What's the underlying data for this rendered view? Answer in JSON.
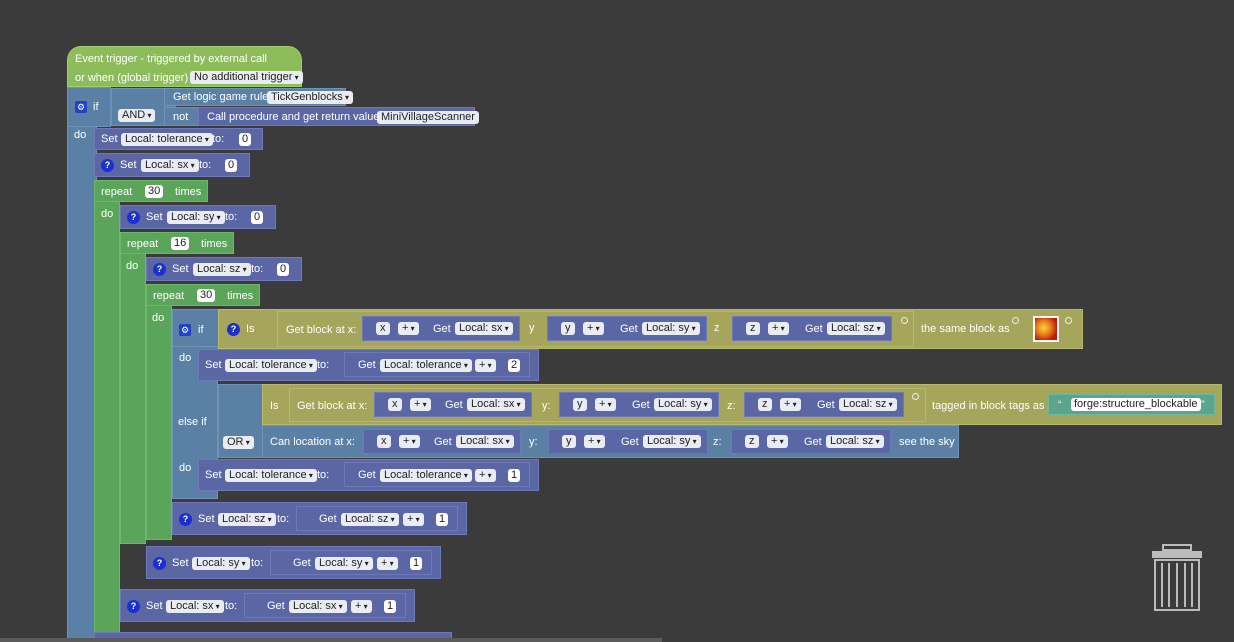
{
  "event": {
    "line1": "Event trigger - triggered by external call",
    "line2": "or when (global trigger)",
    "trigger_dropdown": "No additional trigger",
    "do": "do"
  },
  "if1": {
    "if": "if",
    "get_rule": "Get logic game rule",
    "rule_name": "TickGenblocks",
    "and": "AND",
    "not": "not",
    "call": "Call procedure and get return value",
    "proc_name": "MiniVillageScanner"
  },
  "set": "Set",
  "to": "to:",
  "get": "Get",
  "repeat": "repeat",
  "times": "times",
  "do": "do",
  "vars": {
    "tolerance": "Local: tolerance",
    "sx": "Local: sx",
    "sy": "Local: sy",
    "sz": "Local: sz"
  },
  "nums": {
    "zero": "0",
    "thirty": "30",
    "sixteen": "16",
    "one": "1",
    "two": "2"
  },
  "plus": "+",
  "coords": {
    "x": "x",
    "y": "y",
    "z": "z",
    "yc": "y:",
    "zc": "z:"
  },
  "if2": {
    "if": "if",
    "is": "Is",
    "get_block_at": "Get block at x:",
    "same_block": "the same block as",
    "else_if": "else if",
    "is2": "Is",
    "get_block_at2": "Get block at x:",
    "tagged": "tagged in block tags as",
    "tag": "forge:structure_blockable",
    "or": "OR",
    "can_location": "Can location at x:",
    "see_sky": "see the sky"
  },
  "colors": {
    "background": "#3b3b3b",
    "event": "#8dbd5a",
    "control": "#5b80a5",
    "loop": "#5ba55b",
    "variable": "#5b67a5",
    "world": "#a5a55b",
    "text": "#5ba58c"
  },
  "icons": {
    "help": "?",
    "gear": "⚙",
    "open_quote": "“",
    "close_quote": "”"
  }
}
